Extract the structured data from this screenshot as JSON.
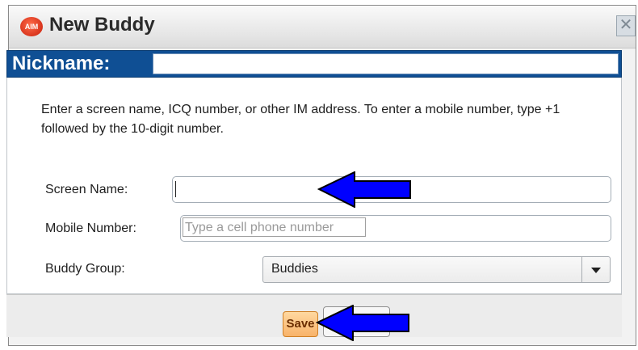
{
  "window": {
    "title": "New Buddy",
    "logo_text": "AIM",
    "close_glyph": "✕"
  },
  "nickname": {
    "label": "Nickname:",
    "value": ""
  },
  "instructions": "Enter a screen name, ICQ number, or other IM address. To enter a mobile number, type +1 followed by the 10-digit number.",
  "form": {
    "screen_name": {
      "label": "Screen Name:",
      "value": ""
    },
    "mobile_number": {
      "label": "Mobile Number:",
      "placeholder": "Type a cell phone number"
    },
    "buddy_group": {
      "label": "Buddy Group:",
      "selected": "Buddies"
    }
  },
  "footer": {
    "save_label": "Save",
    "cancel_label": ""
  },
  "icons": {
    "logo": "aim-logo-icon",
    "close": "close-icon",
    "dropdown": "chevron-down-icon",
    "arrow": "arrow-left-icon"
  },
  "colors": {
    "nickname_bar": "#0f4f94",
    "save_button": "#f8b36a",
    "arrow_fill": "#0000ff"
  }
}
